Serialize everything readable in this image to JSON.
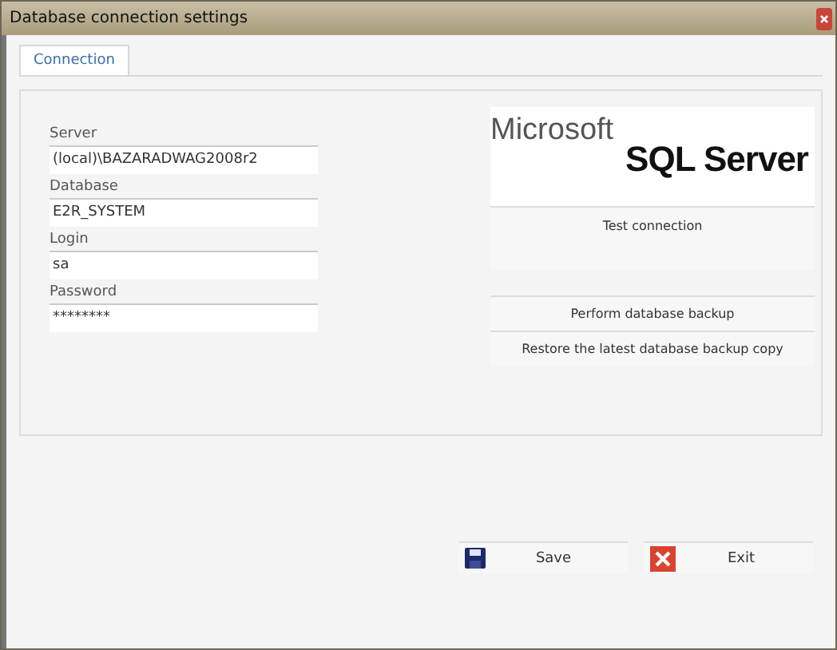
{
  "window": {
    "title": "Database connection settings"
  },
  "tabs": [
    {
      "label": "Connection",
      "selected": true
    }
  ],
  "fields": [
    {
      "label": "Server",
      "value": "(local)\\BAZARADWAG2008r2"
    },
    {
      "label": "Database",
      "value": "E2R_SYSTEM"
    },
    {
      "label": "Login",
      "value": "sa"
    },
    {
      "label": "Password",
      "value": "********"
    }
  ],
  "logo": {
    "line_1": "Microsoft",
    "line_2": "SQL Server"
  },
  "actions": [
    "Test connection",
    "Perform database backup",
    "Restore the latest database backup copy"
  ],
  "buttons": [
    {
      "kind": "save",
      "label": "Save"
    },
    {
      "kind": "exit",
      "label": "Exit"
    }
  ]
}
